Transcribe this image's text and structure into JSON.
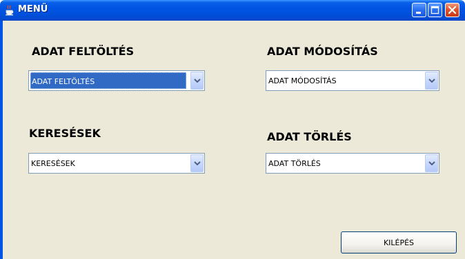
{
  "window": {
    "title": "MENÜ",
    "title_icon": "java-cup-icon",
    "controls": [
      "minimize-icon",
      "maximize-icon",
      "close-icon"
    ],
    "colors": {
      "titlebar": "#0054e3",
      "client": "#ece9d8",
      "selection": "#316ac5"
    }
  },
  "panels": {
    "upload": {
      "heading": "ADAT FELTÖLTÉS",
      "selected_value": "ADAT FELTÖLTÉS"
    },
    "modify": {
      "heading": "ADAT MÓDOSÍTÁS",
      "selected_value": "ADAT MÓDOSÍTÁS"
    },
    "search": {
      "heading": "KERESÉSEK",
      "selected_value": "KERESÉSEK"
    },
    "delete": {
      "heading": "ADAT TÖRLÉS",
      "selected_value": "ADAT TÖRLÉS"
    }
  },
  "exit_button": {
    "label": "KILÉPÉS"
  }
}
